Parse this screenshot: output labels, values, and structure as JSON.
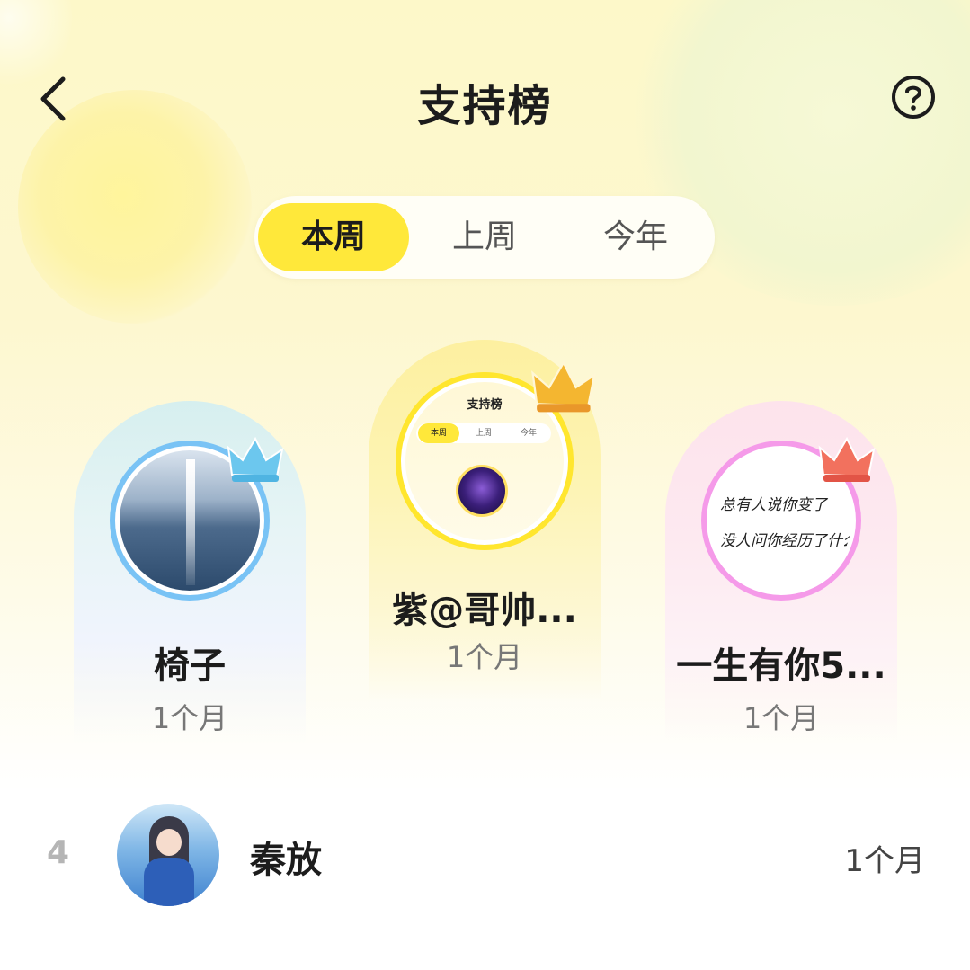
{
  "header": {
    "title": "支持榜",
    "back_icon": "chevron-left-icon",
    "help_icon": "question-circle-icon"
  },
  "tabs": [
    {
      "label": "本周",
      "active": true
    },
    {
      "label": "上周",
      "active": false
    },
    {
      "label": "今年",
      "active": false
    }
  ],
  "podium": [
    {
      "rank": 2,
      "name": "椅子",
      "duration": "1个月",
      "ring_color": "#79c3f5",
      "crown_color": "#6cc7ee",
      "avatar_icon": "sea-light-avatar"
    },
    {
      "rank": 1,
      "name": "紫@哥帅...",
      "duration": "1个月",
      "ring_color": "#ffe62e",
      "crown_color": "#f4b630",
      "avatar_icon": "screenshot-avatar",
      "avatar_text": {
        "title": "支持榜",
        "tabs": [
          "本周",
          "上周",
          "今年"
        ]
      }
    },
    {
      "rank": 3,
      "name": "一生有你5...",
      "duration": "1个月",
      "ring_color": "#f59ae9",
      "crown_color": "#f2715e",
      "avatar_icon": "handwriting-avatar",
      "avatar_text": {
        "line1": "总有人说你变了",
        "line2": "没人问你经历了什么"
      }
    }
  ],
  "list": [
    {
      "rank": "4",
      "name": "秦放",
      "duration": "1个月",
      "avatar_icon": "anime-girl-avatar"
    }
  ],
  "colors": {
    "accent": "#ffe83a",
    "title": "#1c1c1c",
    "muted": "#777777"
  }
}
